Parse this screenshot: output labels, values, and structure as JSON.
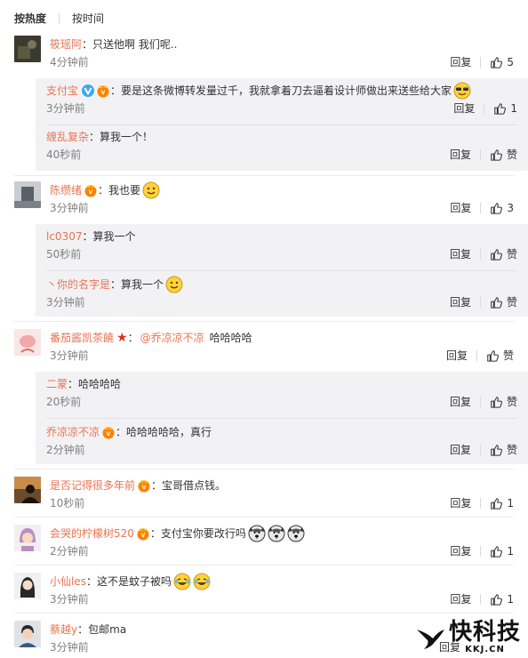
{
  "tabs": {
    "hot": "按热度",
    "time": "按时间"
  },
  "labels": {
    "reply": "回复",
    "like": "赞"
  },
  "colors": {
    "username": "#eb7350",
    "reply_bg": "#f2f2f5",
    "meta": "#808080"
  },
  "comments": [
    {
      "user": "筱瑶阿",
      "text": "只送他啊 我们呢..",
      "time": "4分钟前",
      "likes": "5",
      "avatar_icon": "avatar-dark-photo",
      "replies": [
        {
          "user": "支付宝",
          "text": "要是这条微博转发量过千，我就拿着刀去逼着设计师做出来送些给大家",
          "time": "3分钟前",
          "likes": "1",
          "badges": [
            "verified-v-icon",
            "vip-crown-icon"
          ],
          "emoji": "sunglasses-emoji-icon"
        },
        {
          "user": "缠乱复杂",
          "text": "算我一个！",
          "time": "40秒前",
          "likes": "赞"
        }
      ]
    },
    {
      "user": "陈缵绪",
      "text": "我也要",
      "time": "3分钟前",
      "likes": "3",
      "avatar_icon": "avatar-building-photo",
      "badges": [
        "vip-crown-icon"
      ],
      "emoji": "smile-emoji-icon",
      "replies": [
        {
          "user": "lc0307",
          "text": "算我一个",
          "time": "50秒前",
          "likes": "赞"
        },
        {
          "user": "丶你的名字是",
          "text": "算我一个",
          "time": "3分钟前",
          "likes": "赞",
          "emoji": "smile-emoji-icon"
        }
      ]
    },
    {
      "user": "番茄酱凯茶饒",
      "text": "哈哈哈哈",
      "mention": "@乔凉凉不凉",
      "time": "3分钟前",
      "likes": "赞",
      "avatar_icon": "avatar-pink-photo",
      "star": "★",
      "replies": [
        {
          "user": "二蒙",
          "text": "哈哈哈哈",
          "time": "20秒前",
          "likes": "赞"
        },
        {
          "user": "乔凉凉不凉",
          "text": "哈哈哈哈哈，真行",
          "time": "2分钟前",
          "likes": "赞",
          "badges": [
            "vip-crown-icon"
          ]
        }
      ]
    },
    {
      "user": "是否记得很多年前",
      "text": "宝哥借点钱。",
      "time": "10秒前",
      "likes": "1",
      "avatar_icon": "avatar-silhouette-photo",
      "badges": [
        "vip-crown-icon"
      ]
    },
    {
      "user": "会哭的柠檬树520",
      "text": "支付宝你要改行吗",
      "time": "2分钟前",
      "likes": "1",
      "avatar_icon": "avatar-girl-photo",
      "badges": [
        "vip-crown-icon"
      ],
      "emoji_triple": "husky-emoji-icon"
    },
    {
      "user": "小仙les",
      "text": "这不是蚊子被吗",
      "time": "3分钟前",
      "likes": "1",
      "avatar_icon": "avatar-woman-photo",
      "emoji_double": "laugh-cry-emoji-icon"
    },
    {
      "user": "蔡越y",
      "text": "包邮ma",
      "time": "3分钟前",
      "likes": "",
      "avatar_icon": "avatar-man-photo"
    }
  ],
  "watermark": {
    "big": "快科技",
    "small": "KKJ.CN"
  }
}
